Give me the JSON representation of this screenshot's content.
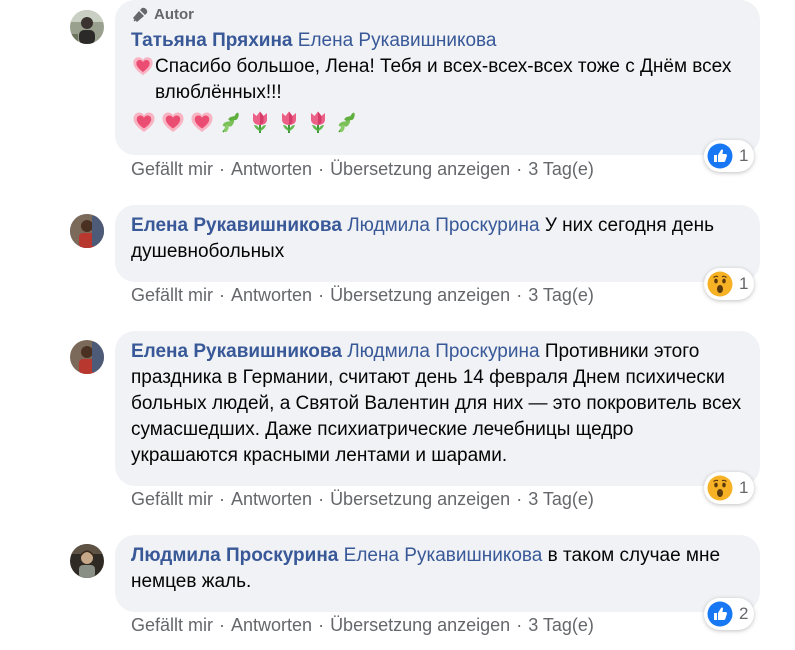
{
  "comments": [
    {
      "badge": "Autor",
      "author": "Татьяна Пряхина",
      "mention": "Елена Рукавишникова",
      "text": "Спасибо большое, Лена! Тебя и всех-всех-всех тоже с Днём всех влюблённых!!!",
      "emojis": [
        "heart-emoji",
        "heart-emoji",
        "heart-emoji",
        "herb-emoji",
        "tulip-emoji",
        "tulip-emoji",
        "tulip-emoji",
        "herb-emoji"
      ],
      "reaction": {
        "type": "like-reaction-icon",
        "count": "1"
      }
    },
    {
      "author": "Елена Рукавишникова",
      "mention": "Людмила Проскурина",
      "text": "У них сегодня день душевнобольных",
      "reaction": {
        "type": "wow-reaction-icon",
        "count": "1"
      }
    },
    {
      "author": "Елена Рукавишникова",
      "mention": "Людмила Проскурина",
      "text": "Противники этого праздника в Германии, считают день 14 февраля Днем психически больных людей, а Святой Валентин для них — это покровитель всех сумасшедших. Даже психиатрические лечебницы щедро украшаются красными лентами и шарами.",
      "reaction": {
        "type": "wow-reaction-icon",
        "count": "1"
      }
    },
    {
      "author": "Людмила Проскурина",
      "mention": "Елена Рукавишникова",
      "text": "в таком случае мне немцев жаль.",
      "reaction": {
        "type": "like-reaction-icon",
        "count": "2"
      }
    }
  ],
  "actions": {
    "like": "Gefällt mir",
    "reply": "Antworten",
    "translate": "Übersetzung anzeigen",
    "time": "3 Tag(e)",
    "separator": "·"
  },
  "colors": {
    "bubble": "#f0f2f5",
    "name": "#385898",
    "meta": "#65676b",
    "like": "#1877f2",
    "wow": "#f7b125"
  }
}
